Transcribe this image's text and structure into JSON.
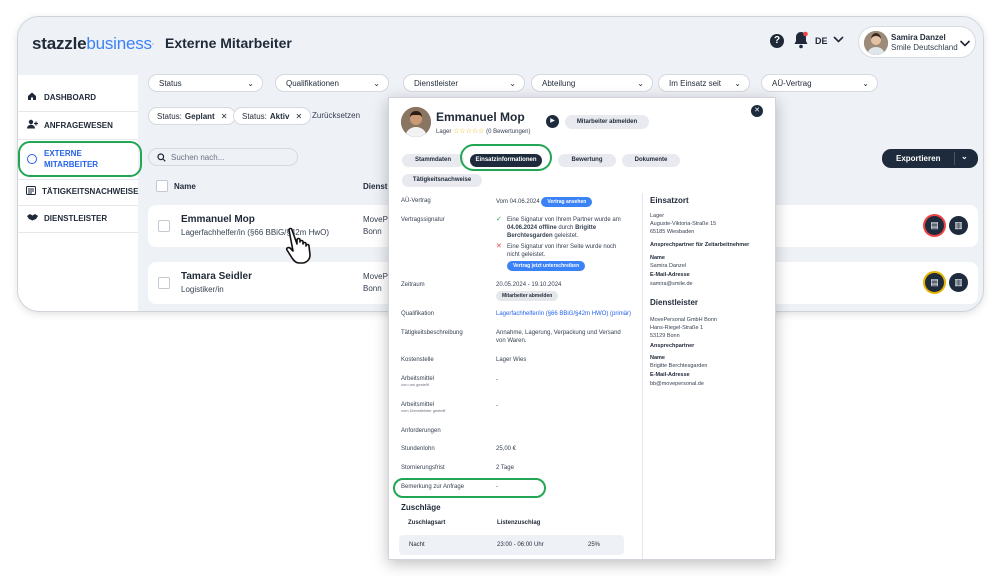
{
  "header": {
    "logo_a": "stazzle",
    "logo_b": "business",
    "separator": "·",
    "title": "Externe Mitarbeiter",
    "help": "?",
    "lang": "DE",
    "user_name": "Samira Danzel",
    "user_org": "Smile Deutschland"
  },
  "sidebar": {
    "items": [
      {
        "label": "DASHBOARD",
        "icon": "home-icon"
      },
      {
        "label": "ANFRAGEWESEN",
        "icon": "user-plus-icon"
      },
      {
        "label_line1": "EXTERNE",
        "label_line2": "MITARBEITER",
        "icon": "target-icon"
      },
      {
        "label": "TÄTIGKEITSNACHWEISE",
        "icon": "list-icon"
      },
      {
        "label": "DIENSTLEISTER",
        "icon": "handshake-icon"
      }
    ]
  },
  "filters": [
    "Status",
    "Qualifikationen",
    "Dienstleister",
    "Abteilung",
    "Im Einsatz seit",
    "AÜ-Vertrag"
  ],
  "chips": [
    {
      "key": "Status:",
      "value": "Geplant"
    },
    {
      "key": "Status:",
      "value": "Aktiv"
    }
  ],
  "reset_label": "Zurücksetzen",
  "search_placeholder": "Suchen nach...",
  "export_label": "Exportieren",
  "table": {
    "col_name": "Name",
    "col_dienst": "Dienstle",
    "rows": [
      {
        "name": "Emmanuel Mop",
        "qual": "Lagerfachhelfer/in (§66 BBiG/§42m HwO)",
        "dl1": "MovePe",
        "dl2": "Bonn"
      },
      {
        "name": "Tamara Seidler",
        "qual": "Logistiker/in",
        "dl1": "MovePe",
        "dl2": "Bonn"
      }
    ]
  },
  "modal": {
    "name": "Emmanuel Mop",
    "role": "Lager",
    "stars": "☆☆☆☆☆",
    "ratings": "(0 Bewertungen)",
    "abmelden": "Mitarbeiter abmelden",
    "tabs": [
      "Stammdaten",
      "Einsatzinformationen",
      "Bewertung",
      "Dokumente",
      "Tätigkeitsnachweise"
    ],
    "fields": {
      "au_label": "AÜ-Vertrag",
      "au_value": "Vom 04.06.2024",
      "au_badge": "Vertrag ansehen",
      "vs_label": "Vertragssignatur",
      "vs_line1": "Eine Signatur von Ihrem Partner wurde am",
      "vs_line2a": "04.06.2024 offline",
      "vs_line2b": "durch",
      "vs_line2c": "Brigitte",
      "vs_line3a": "Berchtesgarden",
      "vs_line3b": "geleistet.",
      "vs_line4": "Eine Signatur von Ihrer Seite wurde noch nicht geleistet.",
      "vs_badge": "Vertrag jetzt unterschreiben",
      "zr_label": "Zeitraum",
      "zr_value": "20.05.2024 - 19.10.2024",
      "zr_badge": "Mitarbeiter abmelden",
      "q_label": "Qualifikation",
      "q_value": "Lagerfachhelfer/in (§66 BBiG/§42m HWO) (primär)",
      "t_label": "Tätigkeitsbeschreibung",
      "t_value": "Annahme, Lagerung, Verpackung und Versand von Waren.",
      "k_label": "Kostenstelle",
      "k_value": "Lager Wies",
      "a1_label": "Arbeitsmittel",
      "a1_small": "von uns gestellt",
      "a1_value": "-",
      "a2_label": "Arbeitsmittel",
      "a2_small": "vom Dienstleister gestellt",
      "a2_value": "-",
      "anf_label": "Anforderungen",
      "sl_label": "Stundenlohn",
      "sl_value": "25,00 €",
      "sf_label": "Stornierungsfrist",
      "sf_value": "2 Tage",
      "bem_label": "Bemerkung zur Anfrage",
      "bem_value": "-"
    },
    "zuschlaege": {
      "title": "Zuschläge",
      "col1": "Zuschlagsart",
      "col2": "Listenzuschlag",
      "row_art": "Nacht",
      "row_time": "23:00 - 06:00 Uhr",
      "row_pct": "25%"
    },
    "right": {
      "einsatzort_h": "Einsatzort",
      "lager_lbl": "Lager",
      "addr1": "Auguste-Viktoria-Straße 15",
      "addr2": "65185 Wiesbaden",
      "ap_h": "Ansprechpartner für Zeitarbeitnehmer",
      "name_lbl": "Name",
      "ap_name": "Samira Danzel",
      "mail_lbl": "E-Mail-Adresse",
      "ap_mail": "samira@smile.de",
      "dl_h": "Dienstleister",
      "dl_name": "MovePersonal GmbH Bonn",
      "dl_addr1": "Hans-Riegel-Straße 1",
      "dl_addr2": "53129 Bonn",
      "dl_ap_h": "Ansprechpartner",
      "dl_name_lbl": "Name",
      "dl_ap_name": "Brigitte Berchtesgarden",
      "dl_mail_lbl": "E-Mail-Adresse",
      "dl_ap_mail": "bb@movepersonal.de"
    }
  },
  "colors": {
    "accent": "#3b82f6",
    "navy": "#1e2b3c",
    "highlight": "#22a653"
  }
}
